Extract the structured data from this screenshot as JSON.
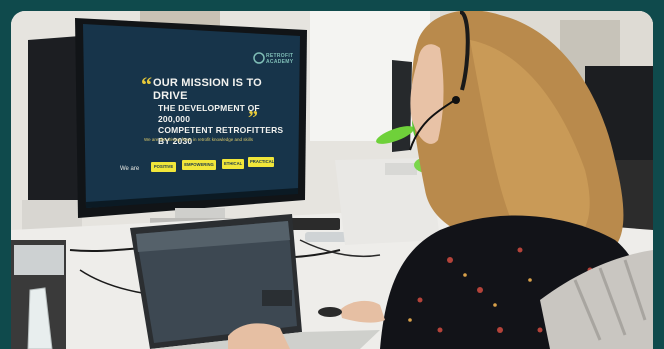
{
  "slide": {
    "title_line1": "Our mission is to drive",
    "title_line2": "the development of 200,000",
    "title_line3": "competent retrofitters by 2030",
    "subtitle": "We are the driving force in retrofit knowledge and skills",
    "logo_line1": "RETROFIT",
    "logo_line2": "ACADEMY",
    "we_are": "We are",
    "chips": [
      "POSITIVE",
      "EMPOWERING",
      "ETHICAL",
      "PRACTICAL"
    ]
  },
  "colors": {
    "background": "#0f4a4c",
    "slide_bg": "#17344a",
    "accent_yellow": "#f1e63a",
    "plant_green": "#6fd13a"
  }
}
